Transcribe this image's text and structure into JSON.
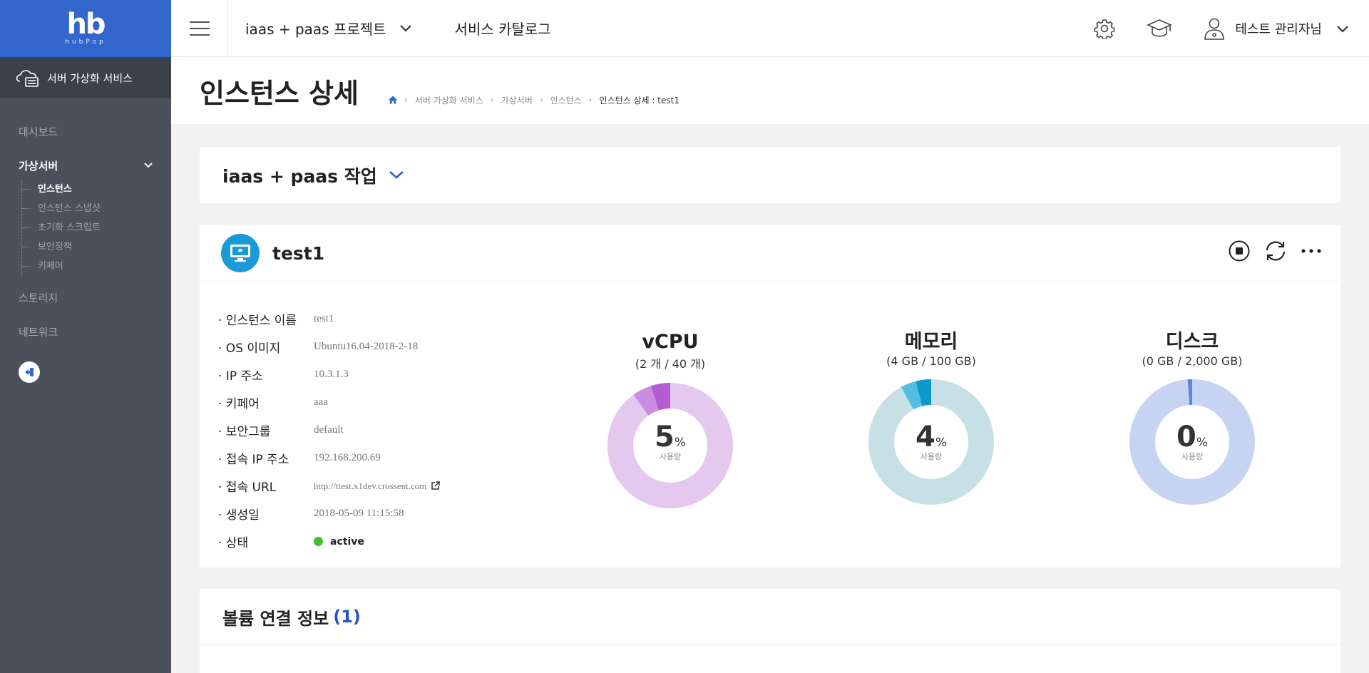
{
  "logo": {
    "main": "hb",
    "sub": "hubPop"
  },
  "sidebar": {
    "service_title": "서버 가상화 서비스",
    "items": [
      {
        "label": "대시보드"
      },
      {
        "label": "가상서버"
      },
      {
        "label": "스토리지"
      },
      {
        "label": "네트워크"
      }
    ],
    "sub_items": [
      {
        "label": "인스턴스"
      },
      {
        "label": "인스턴스 스냅샷"
      },
      {
        "label": "초기화 스크립트"
      },
      {
        "label": "보안정책"
      },
      {
        "label": "키페어"
      }
    ]
  },
  "header": {
    "project": "iaas + paas 프로젝트",
    "catalog": "서비스 카탈로그",
    "user": "테스트 관리자님"
  },
  "page": {
    "title": "인스턴스 상세",
    "breadcrumb": [
      "서버 가상화 서비스",
      "가상서버",
      "인스턴스",
      "인스턴스 상세 : test1"
    ]
  },
  "job": {
    "title": "iaas + paas 작업"
  },
  "instance": {
    "name": "test1",
    "fields": [
      {
        "label": "· 인스턴스 이름",
        "value": "test1"
      },
      {
        "label": "· OS 이미지",
        "value": "Ubuntu16.04-2018-2-18"
      },
      {
        "label": "· IP 주소",
        "value": "10.3.1.3"
      },
      {
        "label": "· 키페어",
        "value": "aaa"
      },
      {
        "label": "· 보안그룹",
        "value": "default"
      },
      {
        "label": "· 접속 IP 주소",
        "value": "192.168.200.69"
      },
      {
        "label": "· 접속 URL",
        "value": "http://ttest.x1dev.crossent.com"
      },
      {
        "label": "· 생성일",
        "value": "2018-05-09 11:15:58"
      },
      {
        "label": "· 상태",
        "value": "active"
      }
    ]
  },
  "gauges": [
    {
      "title": "vCPU",
      "sub": "(2 개 / 40 개)",
      "value": "5",
      "unit": "%",
      "label": "사용량",
      "percent": 5,
      "track": "#e4c8ee",
      "fill": "#b35bd3",
      "fill2": "#ca8ce0"
    },
    {
      "title": "메모리",
      "sub": "(4 GB / 100 GB)",
      "value": "4",
      "unit": "%",
      "label": "사용량",
      "percent": 4,
      "track": "#c7e0e6",
      "fill": "#0d9ac9",
      "fill2": "#52bde0"
    },
    {
      "title": "디스크",
      "sub": "(0 GB / 2,000 GB)",
      "value": "0",
      "unit": "%",
      "label": "사용량",
      "percent": 0,
      "track": "#c6d4f2",
      "fill": "#5b88dc",
      "fill2": "#5b88dc"
    }
  ],
  "volume": {
    "title": "볼륨 연결 정보",
    "count": "(1)"
  },
  "colors": {
    "brand": "#3366cc",
    "sidebar": "#4b505a",
    "active": "#44c02e"
  }
}
